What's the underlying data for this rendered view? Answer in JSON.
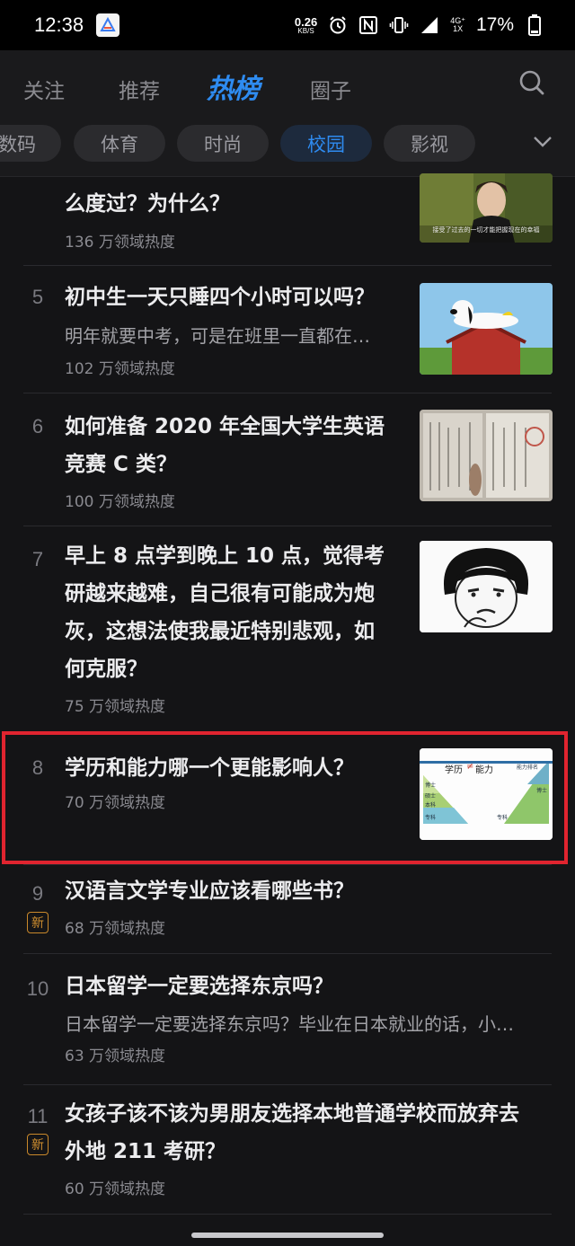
{
  "status_bar": {
    "time": "12:38",
    "net_speed": "0.26",
    "net_unit": "KB/S",
    "net_type_top": "4G⁺",
    "net_type_bottom": "1X",
    "battery": "17%"
  },
  "top_tabs": {
    "items": [
      "关注",
      "推荐",
      "热榜",
      "圈子"
    ],
    "active": "热榜"
  },
  "categories": {
    "items": [
      "数码",
      "体育",
      "时尚",
      "校园",
      "影视"
    ],
    "active": "校园"
  },
  "hot_list": [
    {
      "rank": "",
      "title_lines": [
        "么度过？为什么？"
      ],
      "heat": "136 万领域热度",
      "thumb": "drama-scene",
      "thumb_caption": "接受了过去的一切才能把握现在的幸福"
    },
    {
      "rank": "5",
      "title_lines": [
        "初中生一天只睡四个小时可以吗？"
      ],
      "excerpt": "明年就要中考，可是在班里一直都在…",
      "heat": "102 万领域热度",
      "thumb": "snoopy-doghouse"
    },
    {
      "rank": "6",
      "title_lines": [
        "如何准备 2020 年全国大学生英语",
        "竞赛 C 类？"
      ],
      "heat": "100 万领域热度",
      "thumb": "certificate"
    },
    {
      "rank": "7",
      "title_lines": [
        "早上 8 点学到晚上 10 点，觉得考",
        "研越来越难，自己很有可能成为炮",
        "灰，这想法使我最近特别悲观，如",
        "何克服？"
      ],
      "heat": "75 万领域热度",
      "thumb": "meme-face"
    },
    {
      "rank": "8",
      "title_lines": [
        "学历和能力哪一个更能影响人？"
      ],
      "heat": "70 万领域热度",
      "thumb": "education-vs-ability",
      "thumb_text": {
        "left": "学历",
        "mid": "≠",
        "right": "能力",
        "tr": "能力排名",
        "l1": "博士",
        "l2": "硕士",
        "l3": "本科",
        "l4": "专科",
        "r1": "博士",
        "r2": "专科"
      }
    },
    {
      "rank": "9",
      "badge": "新",
      "title_lines": [
        "汉语言文学专业应该看哪些书？"
      ],
      "heat": "68 万领域热度"
    },
    {
      "rank": "10",
      "title_lines": [
        "日本留学一定要选择东京吗？"
      ],
      "excerpt": "日本留学一定要选择东京吗？毕业在日本就业的话，小…",
      "heat": "63 万领域热度"
    },
    {
      "rank": "11",
      "badge": "新",
      "title_lines": [
        "女孩子该不该为男朋友选择本地普通学校而放弃去",
        "外地 211 考研？"
      ],
      "heat": "60 万领域热度"
    }
  ],
  "colors": {
    "accent": "#2e8bf0",
    "background": "#141416",
    "highlight_box": "#e0242f",
    "new_badge": "#d2902f"
  }
}
